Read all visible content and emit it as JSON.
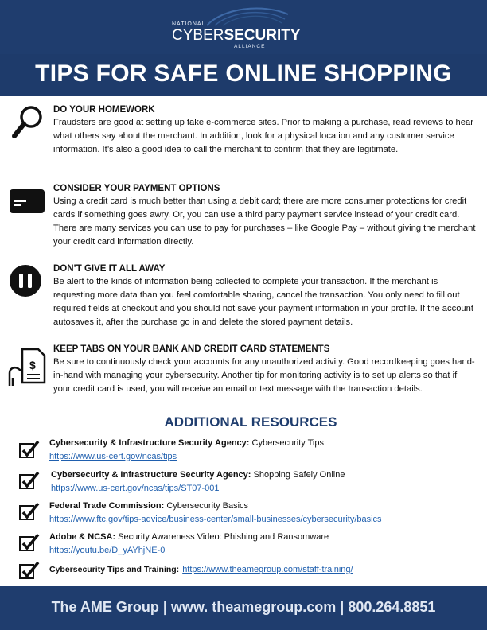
{
  "logo": {
    "top": "NATIONAL",
    "main_light": "CYBER",
    "main_bold": "SECURITY",
    "bottom": "ALLIANCE"
  },
  "title": "TIPS FOR SAFE ONLINE SHOPPING",
  "tips": [
    {
      "icon": "magnifying-glass-icon",
      "heading": "DO YOUR HOMEWORK",
      "body": "Fraudsters are good at setting up fake e-commerce sites. Prior to making a purchase, read reviews to hear what others say about the merchant. In addition, look for a physical location and any customer service information. It’s also a good idea to call the merchant to confirm that they are legitimate."
    },
    {
      "icon": "credit-card-icon",
      "heading": "CONSIDER YOUR PAYMENT OPTIONS",
      "body": "Using a credit card is much better than using a debit card; there are more consumer protections for credit cards if something goes awry. Or, you can use a third party payment service instead of your credit card. There are many services you can use to pay for purchases – like Google Pay – without giving the merchant your credit card information directly."
    },
    {
      "icon": "pause-icon",
      "heading": "DON’T GIVE IT ALL AWAY",
      "body": "Be alert to the kinds of information being collected to complete your transaction. If the merchant is requesting more data than you feel comfortable sharing, cancel the transaction. You only need to fill out required fields at checkout and you should not save your payment information in your profile. If the account autosaves it, after the purchase go in and delete the stored payment details."
    },
    {
      "icon": "statement-icon",
      "heading": "KEEP TABS ON YOUR BANK AND CREDIT CARD STATEMENTS",
      "body": "Be sure to continuously check your accounts for any unauthorized activity. Good recordkeeping goes hand-in-hand with managing your cybersecurity. Another tip for monitoring activity is to set up alerts so that if your credit card is used, you will receive an email or text message with the transaction details."
    }
  ],
  "resources_heading": "ADDITIONAL RESOURCES",
  "resources": [
    {
      "org": "Cybersecurity & Infrastructure Security Agency:",
      "title": " Cybersecurity Tips",
      "url": "https://www.us-cert.gov/ncas/tips"
    },
    {
      "org": "Cybersecurity & Infrastructure Security Agency:",
      "title": " Shopping Safely Online",
      "url": "https://www.us-cert.gov/ncas/tips/ST07-001"
    },
    {
      "org": "Federal Trade Commission:",
      "title": " Cybersecurity Basics",
      "url": "https://www.ftc.gov/tips-advice/business-center/small-businesses/cybersecurity/basics"
    },
    {
      "org": "Adobe & NCSA:",
      "title": " Security Awareness Video: Phishing and Ransomware",
      "url": "https://youtu.be/D_yAYhjNE-0"
    },
    {
      "org": "Cybersecurity Tips and Training:",
      "title": "",
      "url": "https://www.theamegroup.com/staff-training/"
    }
  ],
  "footer": "The AME Group | www. theamegroup.com | 800.264.8851",
  "colors": {
    "header_bg": "#1f3d6e",
    "link": "#1f5fae",
    "heading_blue": "#1f3d6e"
  }
}
